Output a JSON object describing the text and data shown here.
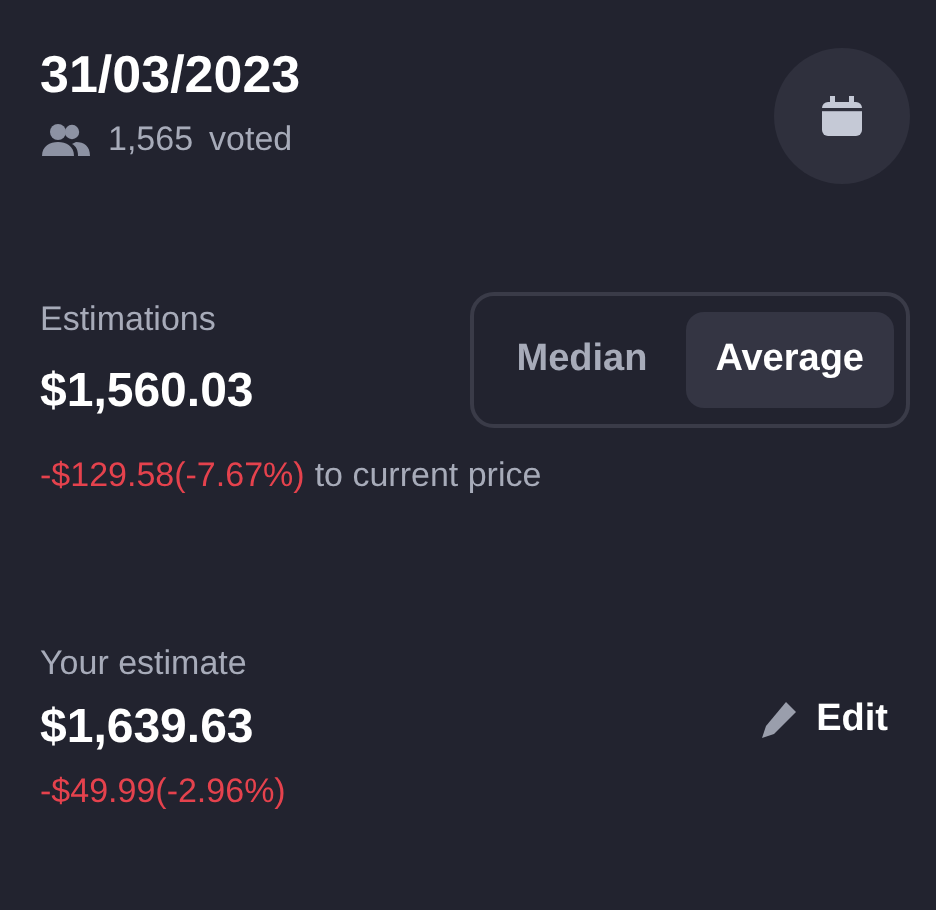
{
  "header": {
    "date": "31/03/2023",
    "voters": "1,565",
    "voted_label": "voted"
  },
  "estimations": {
    "label": "Estimations",
    "value": "$1,560.03",
    "change": "-$129.58(-7.67%)",
    "change_suffix": "to current price",
    "modes": [
      {
        "label": "Median",
        "selected": false
      },
      {
        "label": "Average",
        "selected": true
      }
    ]
  },
  "your_estimate": {
    "label": "Your estimate",
    "value": "$1,639.63",
    "change": "-$49.99(-2.96%)",
    "edit": "Edit"
  }
}
